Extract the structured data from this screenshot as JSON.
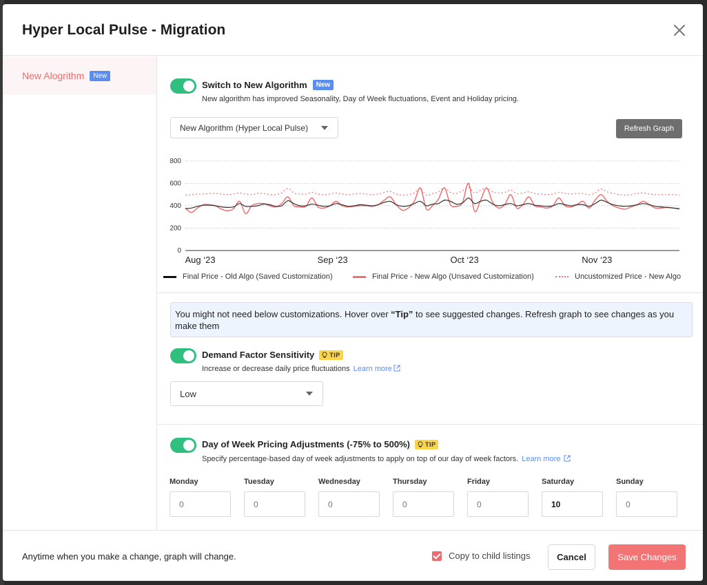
{
  "modal": {
    "title": "Hyper Local Pulse - Migration",
    "close_icon": "close-icon"
  },
  "sidebar": {
    "items": [
      {
        "label": "New Alogrithm",
        "badge": "New"
      }
    ]
  },
  "algorithm": {
    "title": "Switch to New Algorithm",
    "badge": "New",
    "description": "New algorithm has improved Seasonality, Day of Week fluctuations, Event and Holiday pricing.",
    "toggle_on": true
  },
  "graph_select": {
    "value": "New Algorithm (Hyper Local Pulse)"
  },
  "refresh_button": {
    "label": "Refresh Graph"
  },
  "chart_data": {
    "type": "line",
    "x_ticks": [
      "Aug ‘23",
      "Sep ‘23",
      "Oct ‘23",
      "Nov ‘23"
    ],
    "y_ticks": [
      0,
      200,
      400,
      600,
      800
    ],
    "ylim": [
      0,
      800
    ],
    "grid": true,
    "legend_position": "bottom",
    "series": [
      {
        "name": "Final Price - Old Algo (Saved Customization)",
        "color": "#333333",
        "style": "solid",
        "values": [
          375,
          380,
          395,
          405,
          405,
          400,
          390,
          385,
          390,
          420,
          395,
          395,
          400,
          415,
          410,
          395,
          400,
          445,
          420,
          400,
          400,
          415,
          405,
          395,
          400,
          420,
          410,
          395,
          400,
          410,
          405,
          400,
          410,
          430,
          440,
          410,
          395,
          400,
          420,
          440,
          400,
          415,
          420,
          450,
          440,
          415,
          425,
          470,
          420,
          440,
          450,
          415,
          400,
          410,
          420,
          400,
          410,
          420,
          405,
          400,
          395,
          400,
          420,
          410,
          400,
          410,
          410,
          395,
          420,
          450,
          430,
          410,
          400,
          395,
          400,
          410,
          420,
          410,
          395,
          390,
          385,
          380,
          375
        ]
      },
      {
        "name": "Final Price - New Algo (Unsaved Customization)",
        "color": "#f07070",
        "style": "solid",
        "values": [
          380,
          340,
          380,
          410,
          410,
          400,
          370,
          355,
          375,
          440,
          330,
          400,
          420,
          420,
          400,
          390,
          420,
          480,
          400,
          390,
          395,
          470,
          390,
          380,
          400,
          440,
          400,
          390,
          395,
          400,
          400,
          395,
          410,
          450,
          480,
          410,
          360,
          380,
          440,
          560,
          370,
          400,
          460,
          560,
          410,
          395,
          430,
          600,
          350,
          450,
          560,
          430,
          380,
          410,
          500,
          380,
          410,
          480,
          400,
          390,
          380,
          400,
          470,
          400,
          390,
          410,
          440,
          380,
          450,
          500,
          440,
          400,
          380,
          370,
          390,
          410,
          440,
          410,
          380,
          380,
          385,
          380,
          370
        ]
      },
      {
        "name": "Uncustomized Price - New Algo",
        "color": "#f07070",
        "style": "dotted",
        "values": [
          495,
          500,
          505,
          505,
          510,
          510,
          505,
          500,
          505,
          515,
          505,
          500,
          510,
          510,
          500,
          500,
          515,
          555,
          515,
          505,
          505,
          520,
          505,
          500,
          505,
          515,
          505,
          500,
          505,
          510,
          505,
          500,
          505,
          520,
          530,
          505,
          495,
          500,
          515,
          555,
          495,
          510,
          525,
          560,
          520,
          510,
          535,
          565,
          515,
          540,
          560,
          525,
          515,
          520,
          540,
          510,
          515,
          525,
          510,
          505,
          500,
          505,
          520,
          510,
          505,
          510,
          510,
          500,
          515,
          550,
          525,
          510,
          500,
          495,
          500,
          510,
          515,
          505,
          500,
          500,
          500,
          500,
          495
        ]
      }
    ]
  },
  "info_box": {
    "text_before": "You might not need below customizations. Hover over ",
    "text_bold": "“Tip”",
    "text_after": " to see suggested changes. Refresh graph to see changes as you make them"
  },
  "demand_factor": {
    "title": "Demand Factor Sensitivity",
    "tip": "TIP",
    "description": "Increase or decrease daily price fluctuations",
    "learn_more": "Learn more",
    "select_value": "Low",
    "toggle_on": true
  },
  "day_of_week": {
    "title": "Day of Week Pricing Adjustments (-75% to 500%)",
    "tip": "TIP",
    "description": "Specify percentage-based day of week adjustments to apply on top of our day of week factors.",
    "learn_more": "Learn more",
    "toggle_on": true,
    "days": [
      {
        "label": "Monday",
        "value": "",
        "placeholder": "0"
      },
      {
        "label": "Tuesday",
        "value": "",
        "placeholder": "0"
      },
      {
        "label": "Wednesday",
        "value": "",
        "placeholder": "0"
      },
      {
        "label": "Thursday",
        "value": "",
        "placeholder": "0"
      },
      {
        "label": "Friday",
        "value": "",
        "placeholder": "0"
      },
      {
        "label": "Saturday",
        "value": "10",
        "placeholder": "0"
      },
      {
        "label": "Sunday",
        "value": "",
        "placeholder": "0"
      }
    ]
  },
  "footer": {
    "note": "Anytime when you make a change, graph will change.",
    "copy_label": "Copy to child listings",
    "copy_checked": true,
    "cancel_label": "Cancel",
    "save_label": "Save Changes"
  }
}
